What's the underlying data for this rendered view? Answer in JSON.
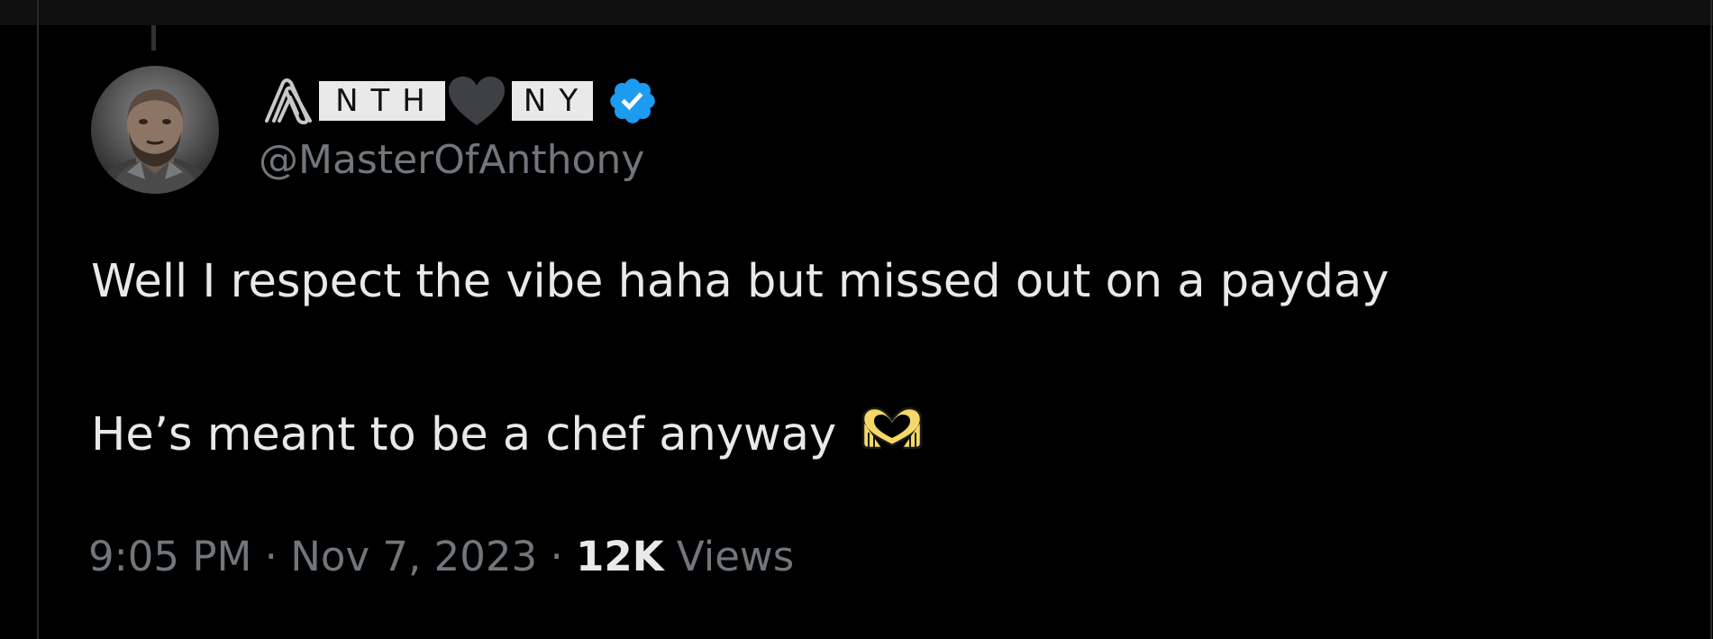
{
  "user": {
    "name_part1": "NTH",
    "name_part2": "NY",
    "handle": "@MasterOfAnthony",
    "icons": {
      "name_prefix": "paperclip-icon",
      "name_middle": "heart-icon",
      "verified": "verified-badge-icon",
      "avatar": "avatar-photo"
    }
  },
  "tweet": {
    "line1": "Well I respect the vibe haha but missed out on a payday",
    "line2": "He’s meant to be a chef anyway",
    "emoji": "heart-hands-emoji"
  },
  "meta": {
    "time": "9:05 PM",
    "separator": "·",
    "date": "Nov 7, 2023",
    "views_count": "12K",
    "views_label": "Views"
  },
  "colors": {
    "background": "#000000",
    "text_primary": "#e7e9ea",
    "text_secondary": "#71767b",
    "verified": "#1d9bf0",
    "emoji": "#f5d867"
  }
}
